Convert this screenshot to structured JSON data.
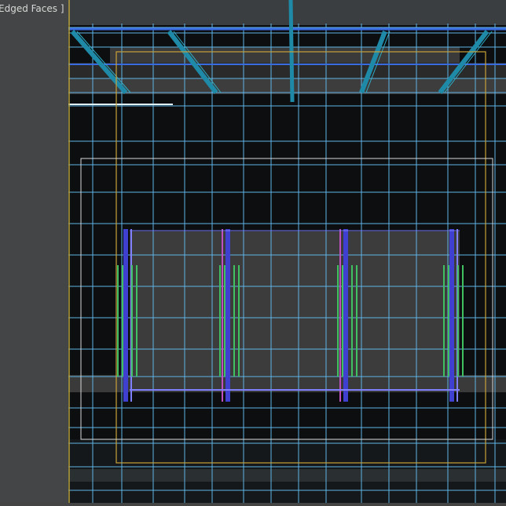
{
  "viewport": {
    "shading_label": "Edged Faces ]",
    "colors": {
      "grid": "#5fb4e6",
      "frame": "#c8a23a",
      "door_frame": "#4040d0",
      "door_pink": "#c050c0",
      "door_green": "#40c060",
      "background": "#0c0e10"
    }
  }
}
